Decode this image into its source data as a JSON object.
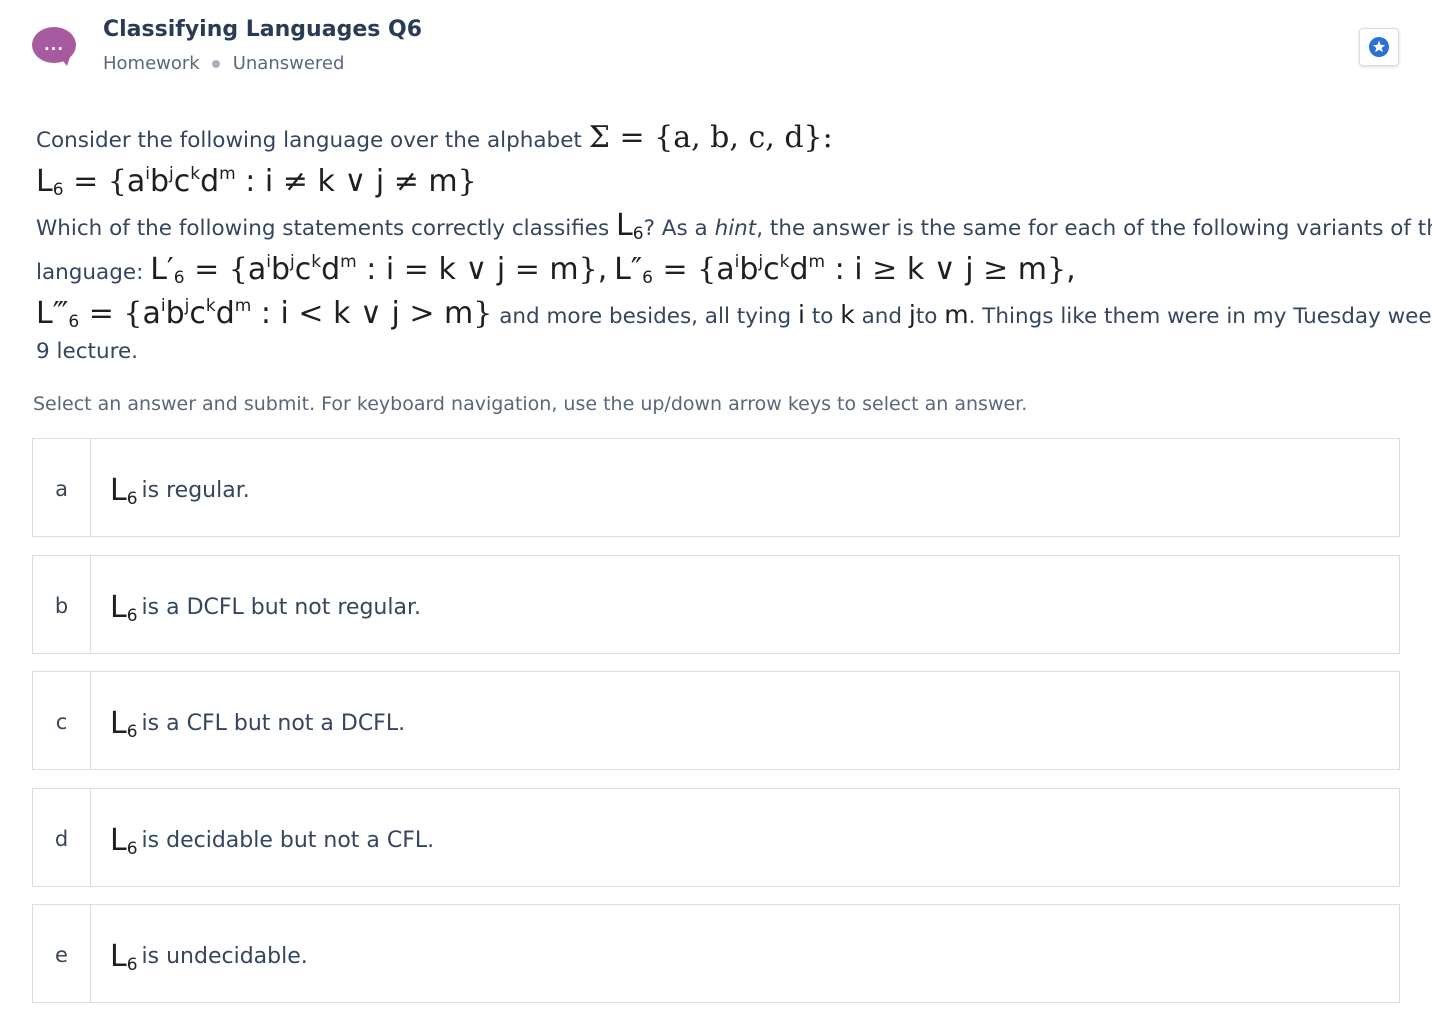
{
  "header": {
    "avatar_label": "...",
    "title": "Classifying Languages Q6",
    "type": "Homework",
    "status": "Unanswered",
    "bookmark_icon": "star-icon"
  },
  "question": {
    "line1_text": "Consider the following language over the alphabet",
    "alphabet": "Σ = {a, b, c, d}:",
    "language_def": "L6 = {a^i b^j c^k d^m : i ≠ k ∨ j ≠ m}",
    "line3_text_1": "Which of the following statements correctly classifies",
    "line3_text_2": "? As a",
    "line3_hint": "hint",
    "line3_text_3": ", the answer is the same for each of the following variants of the",
    "line4_text": "language:",
    "variant1": "L′6 = {a^i b^j c^k d^m : i = k ∨ j = m},",
    "variant2": "L″6 = {a^i b^j c^k d^m : i ≥ k ∨ j ≥ m},",
    "variant3": "L‴6 = {a^i b^j c^k d^m : i < k ∨ j > m}",
    "line5_text_1": "and more besides, all tying",
    "line5_text_2": "to",
    "line5_text_3": "and",
    "line5_text_4": "to",
    "line5_text_5": ". Things like them were in my Tuesday week",
    "line6_text": "9 lecture."
  },
  "instructions": "Select an answer and submit. For keyboard navigation, use the up/down arrow keys to select an answer.",
  "options": [
    {
      "letter": "a",
      "text": "is regular."
    },
    {
      "letter": "b",
      "text": "is a DCFL but not regular."
    },
    {
      "letter": "c",
      "text": "is a CFL but not a DCFL."
    },
    {
      "letter": "d",
      "text": "is decidable but not a CFL."
    },
    {
      "letter": "e",
      "text": "is undecidable."
    }
  ],
  "colors": {
    "avatar": "#a85aa0",
    "star": "#2c6fd6",
    "text": "#34465e"
  }
}
